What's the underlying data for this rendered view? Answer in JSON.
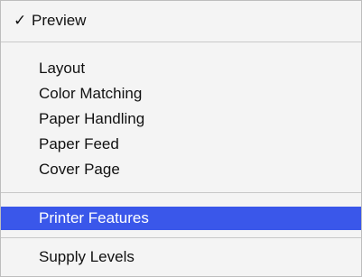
{
  "menu": {
    "items": [
      {
        "label": "Preview",
        "checked": true,
        "check_glyph": "✓"
      },
      {
        "label": "Layout"
      },
      {
        "label": "Color Matching"
      },
      {
        "label": "Paper Handling"
      },
      {
        "label": "Paper Feed"
      },
      {
        "label": "Cover Page"
      },
      {
        "label": "Printer Features",
        "highlighted": true
      },
      {
        "label": "Supply Levels"
      }
    ],
    "highlight_color": "#3a57ea"
  }
}
